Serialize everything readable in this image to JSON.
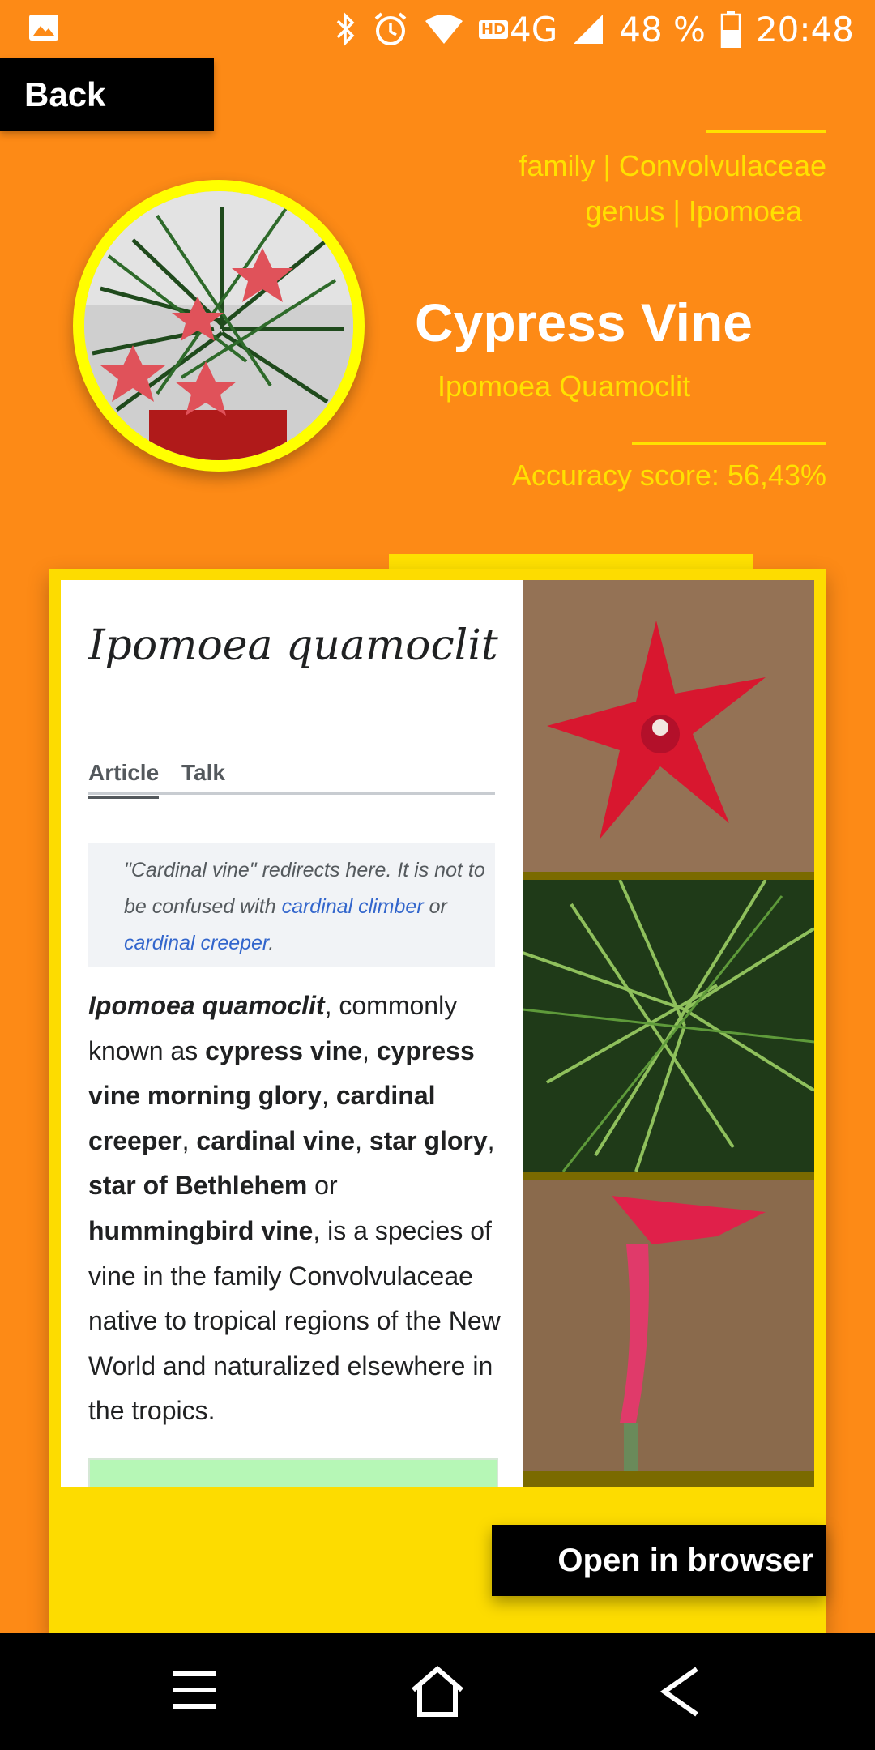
{
  "status_bar": {
    "battery": "48 %",
    "time": "20:48",
    "network": "4G",
    "hd_badge": "HD",
    "icons": [
      "gallery-icon",
      "bluetooth-icon",
      "alarm-icon",
      "wifi-icon",
      "signal-icon",
      "battery-icon"
    ]
  },
  "header": {
    "back_label": "Back",
    "family_line": "family | Convolvulaceae",
    "genus_line": "genus | Ipomoea",
    "common_name": "Cypress Vine",
    "scientific_name": "Ipomoea Quamoclit",
    "accuracy": "Accuracy score: 56,43%"
  },
  "wiki": {
    "title": "Ipomoea quamoclit",
    "tabs": [
      "Article",
      "Talk"
    ],
    "hatnote_prefix": "\"Cardinal vine\" redirects here. It is not to be confused with ",
    "hatnote_link1": "cardinal climber",
    "hatnote_or": " or ",
    "hatnote_link2": "cardinal creeper",
    "hatnote_end": ".",
    "body": [
      {
        "t": "Ipomoea quamoclit",
        "s": "bi"
      },
      {
        "t": ", commonly known as ",
        "s": "n"
      },
      {
        "t": "cypress vine",
        "s": "b"
      },
      {
        "t": ", ",
        "s": "n"
      },
      {
        "t": "cypress vine morning glory",
        "s": "b"
      },
      {
        "t": ", ",
        "s": "n"
      },
      {
        "t": "cardinal creeper",
        "s": "b"
      },
      {
        "t": ", ",
        "s": "n"
      },
      {
        "t": "cardinal vine",
        "s": "b"
      },
      {
        "t": ", ",
        "s": "n"
      },
      {
        "t": "star glory",
        "s": "b"
      },
      {
        "t": ", ",
        "s": "n"
      },
      {
        "t": "star of Bethlehem",
        "s": "b"
      },
      {
        "t": " or ",
        "s": "n"
      },
      {
        "t": "hummingbird vine",
        "s": "b"
      },
      {
        "t": ", is a species of vine in the family Convolvulaceae native to tropical regions of the New World and naturalized elsewhere in the tropics.",
        "s": "n"
      }
    ]
  },
  "open_browser_label": "Open in browser",
  "colors": {
    "background": "#FD8A16",
    "accent_yellow": "#FFE100",
    "card_yellow": "#FDDC00",
    "button_black": "#000000"
  },
  "nav_icons": [
    "menu-icon",
    "home-icon",
    "back-arrow-icon"
  ]
}
